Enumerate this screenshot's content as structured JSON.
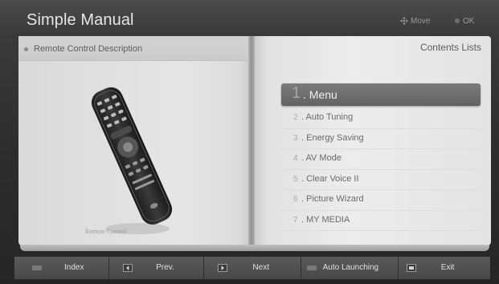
{
  "header": {
    "title": "Simple Manual",
    "hint_move": "Move",
    "hint_ok": "OK"
  },
  "left_page": {
    "header_label": "Remote Control Description",
    "remote_caption": "Remote Control"
  },
  "right_page": {
    "title": "Contents Lists",
    "items": [
      {
        "num": "1",
        "label": ". Menu",
        "selected": true
      },
      {
        "num": "2",
        "label": ". Auto Tuning"
      },
      {
        "num": "3",
        "label": ". Energy Saving"
      },
      {
        "num": "4",
        "label": ". AV Mode"
      },
      {
        "num": "5",
        "label": ". Clear Voice II"
      },
      {
        "num": "6",
        "label": ". Picture Wizard"
      },
      {
        "num": "7",
        "label": ". MY MEDIA"
      }
    ]
  },
  "bottom_bar": {
    "index": "Index",
    "prev": "Prev.",
    "next": "Next",
    "auto_launching": "Auto Launching",
    "exit": "Exit"
  },
  "icons": {
    "move": "dpad-icon",
    "ok": "ok-dot-icon",
    "index": "index-icon",
    "prev": "prev-icon",
    "next": "next-icon",
    "auto_launching": "auto-launching-icon",
    "exit": "exit-icon"
  }
}
